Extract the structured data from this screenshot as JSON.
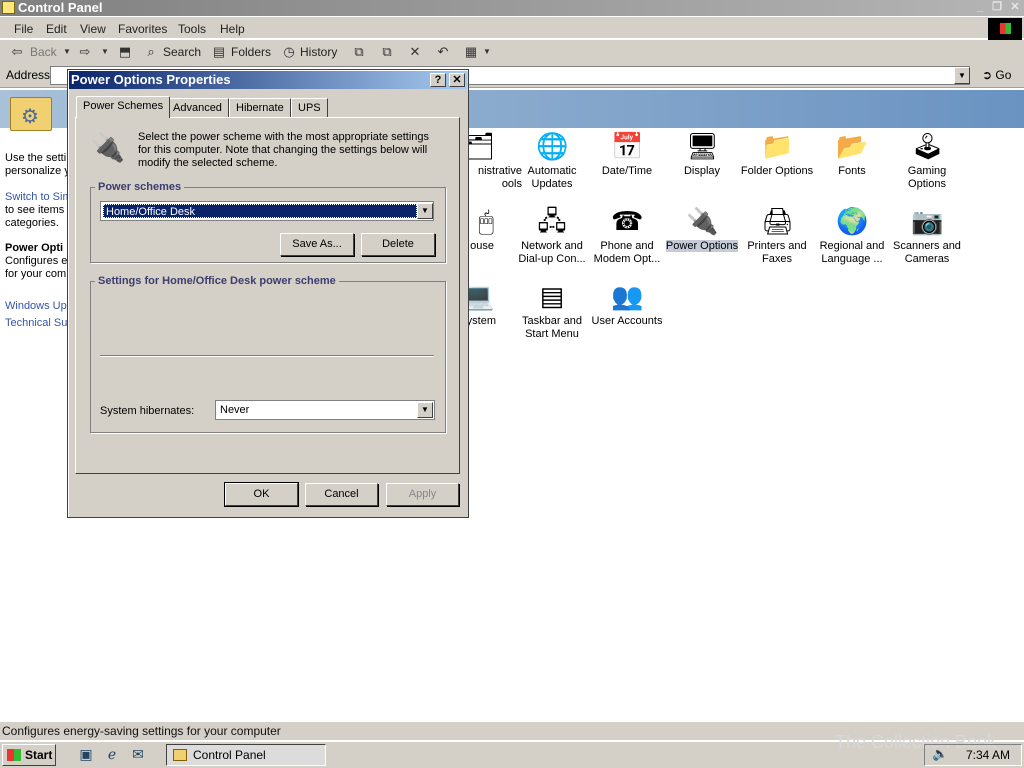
{
  "window": {
    "title": "Control Panel"
  },
  "menu": [
    "File",
    "Edit",
    "View",
    "Favorites",
    "Tools",
    "Help"
  ],
  "toolbar": {
    "back": "Back",
    "search": "Search",
    "folders": "Folders",
    "history": "History"
  },
  "address": {
    "label": "Address",
    "go": "Go"
  },
  "left_pane": {
    "line1": "Use the setti",
    "line2": "personalize y",
    "switch1": "Switch to Sim",
    "switch2": "to see items",
    "switch3": "categories.",
    "sel_title": "Power Opti",
    "sel_desc1": "Configures e",
    "sel_desc2": "for your com",
    "link1": "Windows Upd",
    "link2": "Technical Sup"
  },
  "icons": {
    "admin": "nistrative\nools",
    "auto_updates": "Automatic\nUpdates",
    "datetime": "Date/Time",
    "display": "Display",
    "folder_options": "Folder Options",
    "fonts": "Fonts",
    "gaming": "Gaming\nOptions",
    "mouse": "ouse",
    "network": "Network and\nDial-up Con...",
    "phone": "Phone and\nModem Opt...",
    "power": "Power Options",
    "printers": "Printers and\nFaxes",
    "regional": "Regional and\nLanguage ...",
    "scanners": "Scanners and\nCameras",
    "system": "ystem",
    "taskbar": "Taskbar and\nStart Menu",
    "users": "User Accounts"
  },
  "dialog": {
    "title": "Power Options Properties",
    "help_btn": "?",
    "close_btn": "✕",
    "tabs": [
      "Power Schemes",
      "Advanced",
      "Hibernate",
      "UPS"
    ],
    "description": "Select the power scheme with the most appropriate settings for this computer. Note that changing the settings below will modify the selected scheme.",
    "schemes_label": "Power schemes",
    "scheme_value": "Home/Office Desk",
    "save_as": "Save As...",
    "delete": "Delete",
    "settings_label": "Settings for Home/Office Desk power scheme",
    "hibernate_label": "System hibernates:",
    "hibernate_value": "Never",
    "ok": "OK",
    "cancel": "Cancel",
    "apply": "Apply"
  },
  "status": {
    "text": "Configures energy-saving settings for your computer"
  },
  "taskbar": {
    "start": "Start",
    "task": "Control Panel",
    "clock": "7:34 AM"
  },
  "watermark": "The Collection Book"
}
